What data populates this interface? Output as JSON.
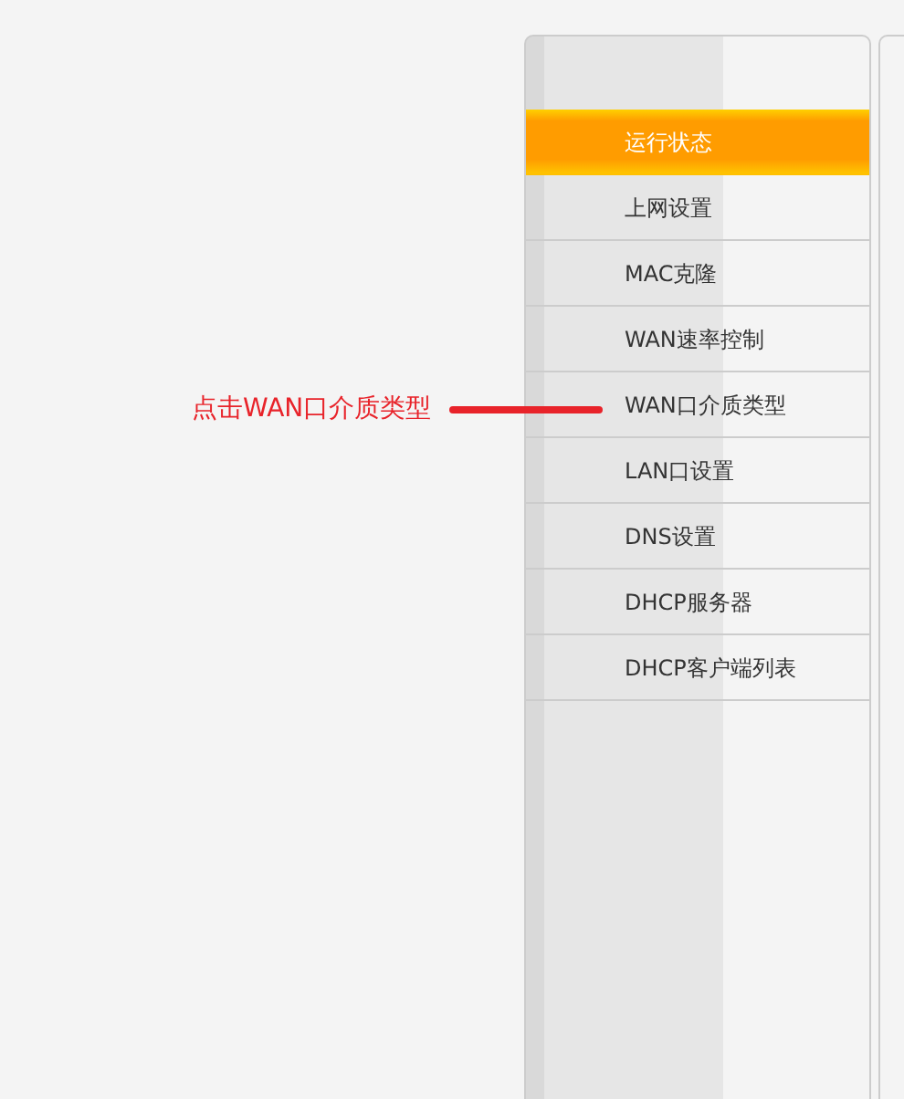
{
  "menu": {
    "items": [
      {
        "label": "运行状态",
        "selected": true
      },
      {
        "label": "上网设置",
        "selected": false
      },
      {
        "label": "MAC克隆",
        "selected": false
      },
      {
        "label": "WAN速率控制",
        "selected": false
      },
      {
        "label": "WAN口介质类型",
        "selected": false
      },
      {
        "label": "LAN口设置",
        "selected": false
      },
      {
        "label": "DNS设置",
        "selected": false
      },
      {
        "label": "DHCP服务器",
        "selected": false
      },
      {
        "label": "DHCP客户端列表",
        "selected": false
      }
    ]
  },
  "annotation": {
    "text": "点击WAN口介质类型"
  }
}
